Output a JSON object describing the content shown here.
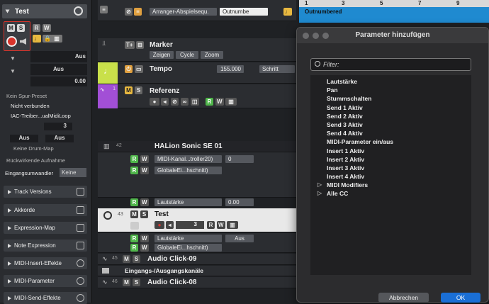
{
  "inspector": {
    "track_name": "Test",
    "out_label1": "Aus",
    "out_label2": "Aus",
    "value_000": "0.00",
    "preset": "Kein Spur-Preset",
    "connection": "Nicht verbunden",
    "midi_port": "IAC-Treiber...ualMidiLoop",
    "channel": "3",
    "in_a": "Aus",
    "in_b": "Aus",
    "drum_map": "Keine Drum-Map",
    "retro": "Rückwirkende Aufnahme",
    "converter_label": "Eingangsumwandler",
    "converter_value": "Keine",
    "sections": [
      "Track Versions",
      "Akkorde",
      "Expression-Map",
      "Note Expression",
      "MIDI-Insert-Effekte",
      "MIDI-Parameter",
      "MIDI-Send-Effekte"
    ]
  },
  "tracks": {
    "arranger_select": "Arranger-Abspielsequ.",
    "arranger_field": "Outnumbe",
    "marker": "Marker",
    "marker_buttons": [
      "Zeigen",
      "Cycle",
      "Zoom"
    ],
    "tempo": "Tempo",
    "tempo_value": "155.000",
    "tempo_mode": "Schritt",
    "ref_num": "1",
    "referenz": "Referenz",
    "halion_num": "42",
    "halion": "HALion Sonic SE 01",
    "halion_lane1": "MIDI-Kanal...troller20)",
    "halion_lane1_val": "0",
    "halion_lane2": "GlobaleEi...hschnitt)",
    "lautstaerke": "Lautstärke",
    "lautstaerke_val": "0.00",
    "test_num": "43",
    "test": "Test",
    "test_ch": "3",
    "test_lane1": "Lautstärke",
    "test_lane1_val": "Aus",
    "test_lane2": "GlobaleEi...hschnitt)",
    "n45": "45",
    "audio9": "Audio Click-09",
    "io": "Eingangs-/Ausgangskanäle",
    "n46": "46",
    "audio8": "Audio Click-08"
  },
  "ruler": {
    "marks": [
      "1",
      "3",
      "5",
      "7",
      "9"
    ],
    "event": "Outnumbered"
  },
  "dialog": {
    "title": "Parameter hinzufügen",
    "filter_placeholder": "Filter:",
    "params": [
      "Lautstärke",
      "Pan",
      "Stummschalten",
      "Send 1 Aktiv",
      "Send 2 Aktiv",
      "Send 3 Aktiv",
      "Send 4 Aktiv",
      "MIDI-Parameter ein/aus",
      "Insert 1 Aktiv",
      "Insert 2 Aktiv",
      "Insert 3 Aktiv",
      "Insert 4 Aktiv",
      "MIDI Modifiers",
      "Alle CC"
    ],
    "cancel": "Abbrechen",
    "ok": "OK"
  },
  "colors": {
    "tempo": "#c9e04a",
    "referenz": "#a24fd6",
    "accent": "#1f8ad0",
    "record": "#d9342b"
  }
}
